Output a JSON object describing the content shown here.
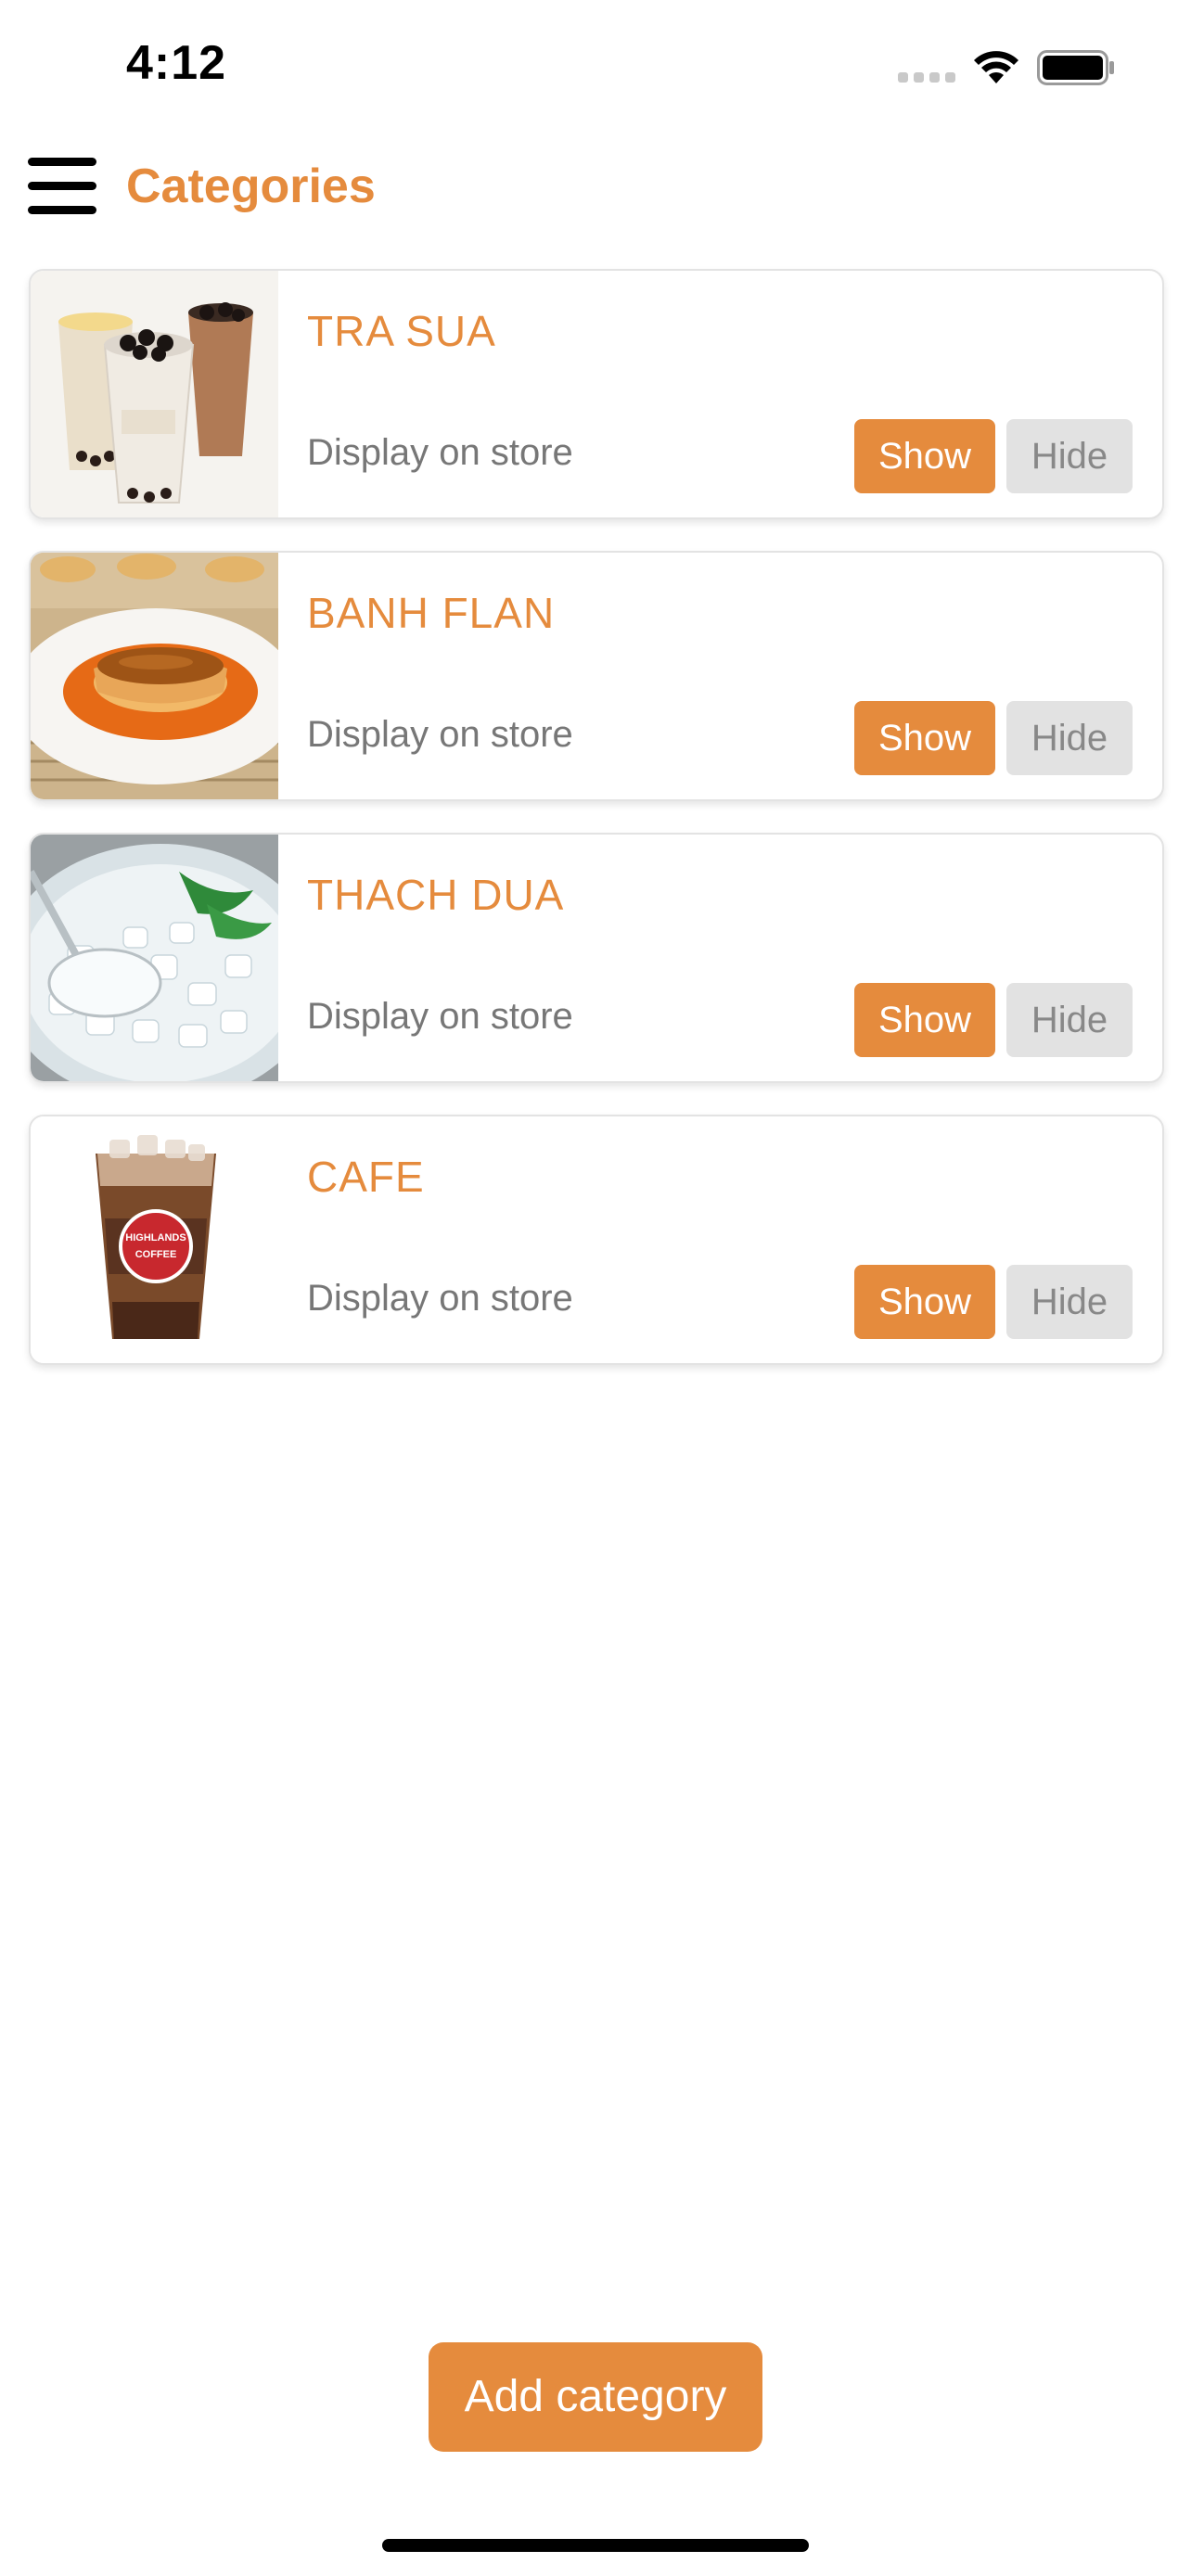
{
  "status_bar": {
    "time": "4:12"
  },
  "header": {
    "title": "Categories",
    "menu_icon": "hamburger-menu-icon"
  },
  "colors": {
    "accent": "#e58b3d",
    "muted_button": "#e2e2e2",
    "label_gray": "#777777"
  },
  "categories": [
    {
      "name": "TRA SUA",
      "display_label": "Display on store",
      "show_label": "Show",
      "hide_label": "Hide",
      "thumbnail": "milk-tea-image"
    },
    {
      "name": "BANH FLAN",
      "display_label": "Display on store",
      "show_label": "Show",
      "hide_label": "Hide",
      "thumbnail": "flan-image"
    },
    {
      "name": "THACH DUA",
      "display_label": "Display on store",
      "show_label": "Show",
      "hide_label": "Hide",
      "thumbnail": "coconut-jelly-image"
    },
    {
      "name": "CAFE",
      "display_label": "Display on store",
      "show_label": "Show",
      "hide_label": "Hide",
      "thumbnail": "iced-coffee-image",
      "thumbnail_text": [
        "HIGHLANDS",
        "COFFEE"
      ]
    }
  ],
  "footer": {
    "add_label": "Add category"
  }
}
